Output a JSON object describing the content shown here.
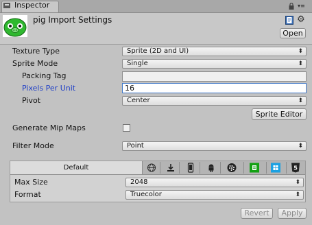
{
  "window": {
    "tab_label": "Inspector"
  },
  "header": {
    "title": "pig Import Settings",
    "open_label": "Open"
  },
  "settings": {
    "texture_type": {
      "label": "Texture Type",
      "value": "Sprite (2D and UI)"
    },
    "sprite_mode": {
      "label": "Sprite Mode",
      "value": "Single"
    },
    "packing_tag": {
      "label": "Packing Tag",
      "value": ""
    },
    "pixels_per_unit": {
      "label": "Pixels Per Unit",
      "value": "16"
    },
    "pivot": {
      "label": "Pivot",
      "value": "Center"
    },
    "sprite_editor_label": "Sprite Editor",
    "generate_mip_maps": {
      "label": "Generate Mip Maps",
      "checked": false
    },
    "filter_mode": {
      "label": "Filter Mode",
      "value": "Point"
    }
  },
  "platform": {
    "default_tab": "Default",
    "icons": [
      "web-globe-icon",
      "standalone-download-icon",
      "iphone-icon",
      "android-icon",
      "blackberry-icon",
      "windows-store-icon",
      "windows-phone-icon",
      "html5-icon"
    ],
    "max_size": {
      "label": "Max Size",
      "value": "2048"
    },
    "format": {
      "label": "Format",
      "value": "Truecolor"
    }
  },
  "footer": {
    "revert_label": "Revert",
    "apply_label": "Apply"
  },
  "colors": {
    "accent_label": "#1f3fc7",
    "focus_border": "#3f78c8",
    "pig_green": "#2fb82f"
  }
}
